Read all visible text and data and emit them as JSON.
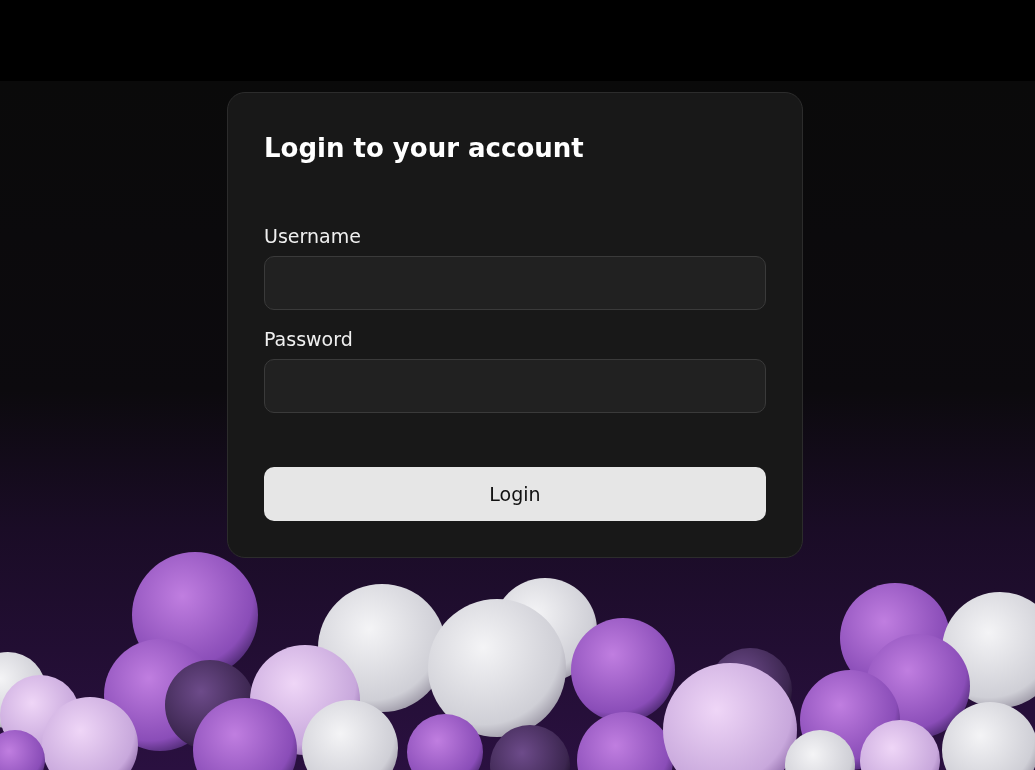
{
  "login_form": {
    "title": "Login to your account",
    "fields": [
      {
        "label": "Username"
      },
      {
        "label": "Password"
      }
    ],
    "button": "Login"
  }
}
